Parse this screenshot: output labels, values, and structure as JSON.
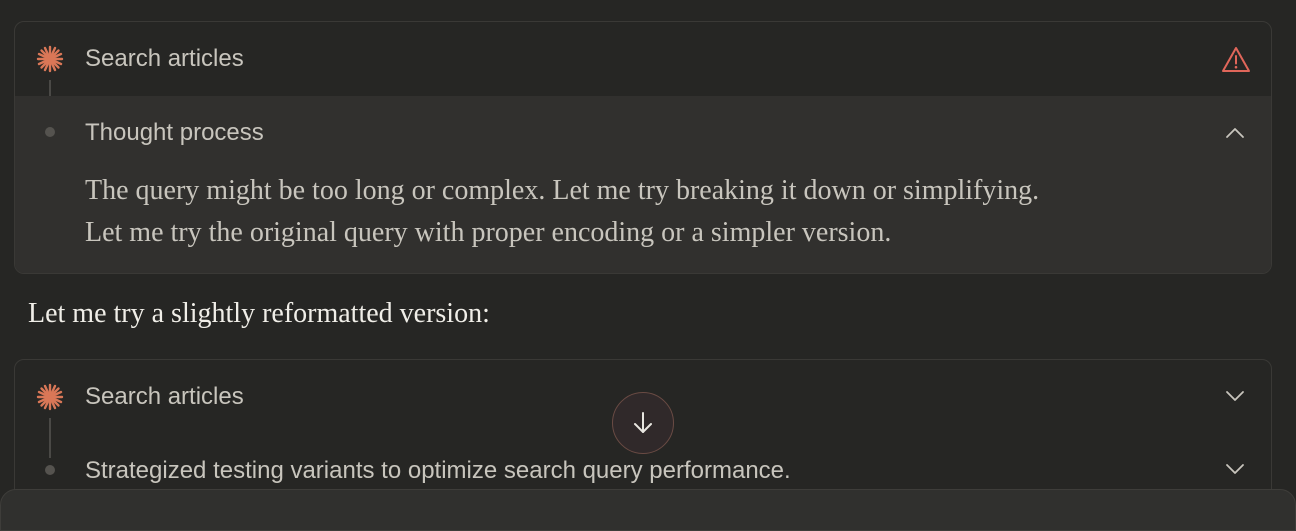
{
  "colors": {
    "accent": "#d97757",
    "warning": "#e0665a",
    "background": "#262624",
    "panel": "#31302e"
  },
  "block1": {
    "tool_label": "Search articles",
    "status_icon": "warning-triangle-icon",
    "thought_title": "Thought process",
    "thought_lines": [
      "The query might be too long or complex. Let me try breaking it down or simplifying.",
      "Let me try the original query with proper encoding or a simpler version."
    ]
  },
  "message_text": "Let me try a slightly reformatted version:",
  "block2": {
    "tool_label": "Search articles",
    "thought_title": "Strategized testing variants to optimize search query performance."
  },
  "scroll_button_icon": "arrow-down-icon"
}
